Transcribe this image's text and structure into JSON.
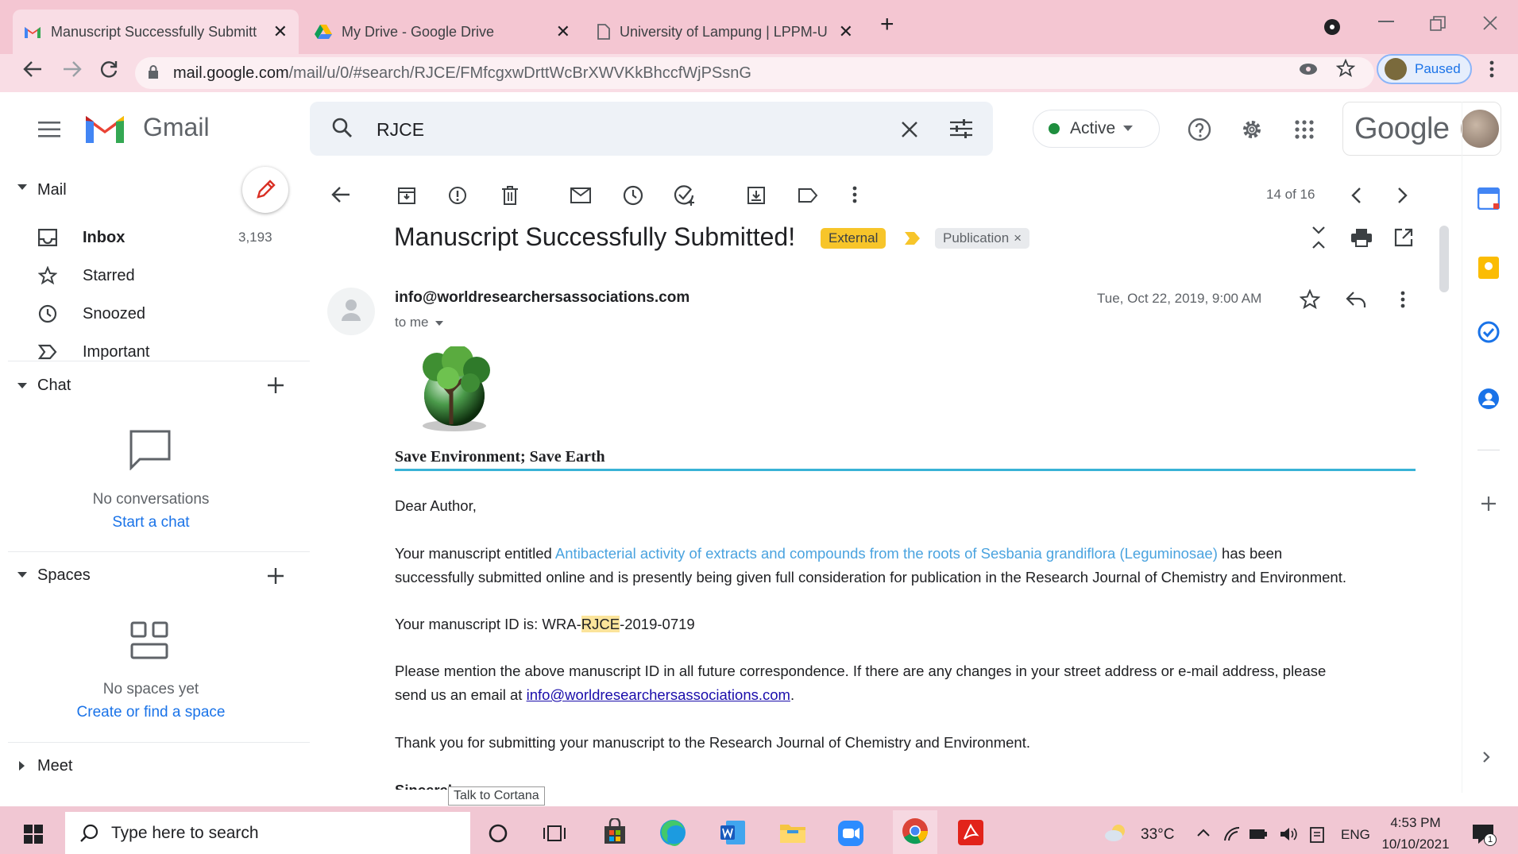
{
  "colors": {
    "chrome_tab_bg": "#f4c6d2",
    "accent": "#1a73e8",
    "highlight": "#fbe49b",
    "external_chip": "#f7c52a",
    "status_active": "#1e8e3e"
  },
  "browser": {
    "tabs": [
      {
        "title": "Manuscript Successfully Submitt",
        "icon": "gmail-icon",
        "close": "✕"
      },
      {
        "title": "My Drive - Google Drive",
        "icon": "drive-icon",
        "close": "✕"
      },
      {
        "title": "University of Lampung | LPPM-U",
        "icon": "page-icon",
        "close": "✕"
      }
    ],
    "new_tab": "+",
    "url_host": "mail.google.com",
    "url_path": "/mail/u/0/#search/RJCE/FMfcgxwDrttWcBrXWVKkBhccfWjPSsnG",
    "profile_label": "Paused"
  },
  "gmail": {
    "brand": "Gmail",
    "search_value": "RJCE",
    "status": "Active",
    "google_label": "Google",
    "sidebar": {
      "mail_header": "Mail",
      "items": [
        {
          "label": "Inbox",
          "count": "3,193",
          "icon": "inbox-icon"
        },
        {
          "label": "Starred",
          "count": "",
          "icon": "star-icon"
        },
        {
          "label": "Snoozed",
          "count": "",
          "icon": "clock-icon"
        },
        {
          "label": "Important",
          "count": "",
          "icon": "important-icon"
        }
      ],
      "chat_header": "Chat",
      "chat_empty": "No conversations",
      "chat_link": "Start a chat",
      "spaces_header": "Spaces",
      "spaces_empty": "No spaces yet",
      "spaces_link": "Create or find a space",
      "meet_header": "Meet"
    },
    "pagination": "14 of 16",
    "message": {
      "subject": "Manuscript Successfully Submitted!",
      "label_external": "External",
      "label_publication": "Publication",
      "label_remove": "×",
      "sender": "info@worldresearchersassociations.com",
      "to": "to me",
      "date": "Tue, Oct 22, 2019, 9:00 AM",
      "logo_caption": "Save Environment; Save Earth",
      "greeting": "Dear Author,",
      "p1_before": "Your manuscript entitled ",
      "p1_title": "Antibacterial activity of extracts and compounds from the roots of Sesbania grandiflora (Leguminosae)",
      "p1_after": " has been",
      "p1_line2": "successfully submitted online and is presently being given full consideration for publication in the Research Journal of Chemistry and Environment.",
      "id_prefix": "Your manuscript ID is: WRA-",
      "id_highlight": "RJCE",
      "id_suffix": "-2019-0719",
      "p3_line1": "Please mention the above manuscript ID in all future correspondence. If there are any changes in your street address or e-mail address, please",
      "p3_before": "send us an email at ",
      "p3_link": "info@worldresearchersassociations.com",
      "p3_after": ".",
      "p4": "Thank you for submitting your manuscript to the Research Journal of Chemistry and Environment.",
      "sign": "Sincerel"
    }
  },
  "taskbar": {
    "search_placeholder": "Type here to search",
    "tooltip": "Talk to Cortana",
    "temperature": "33°C",
    "lang": "ENG",
    "time": "4:53 PM",
    "date": "10/10/2021",
    "notif_count": "1"
  }
}
